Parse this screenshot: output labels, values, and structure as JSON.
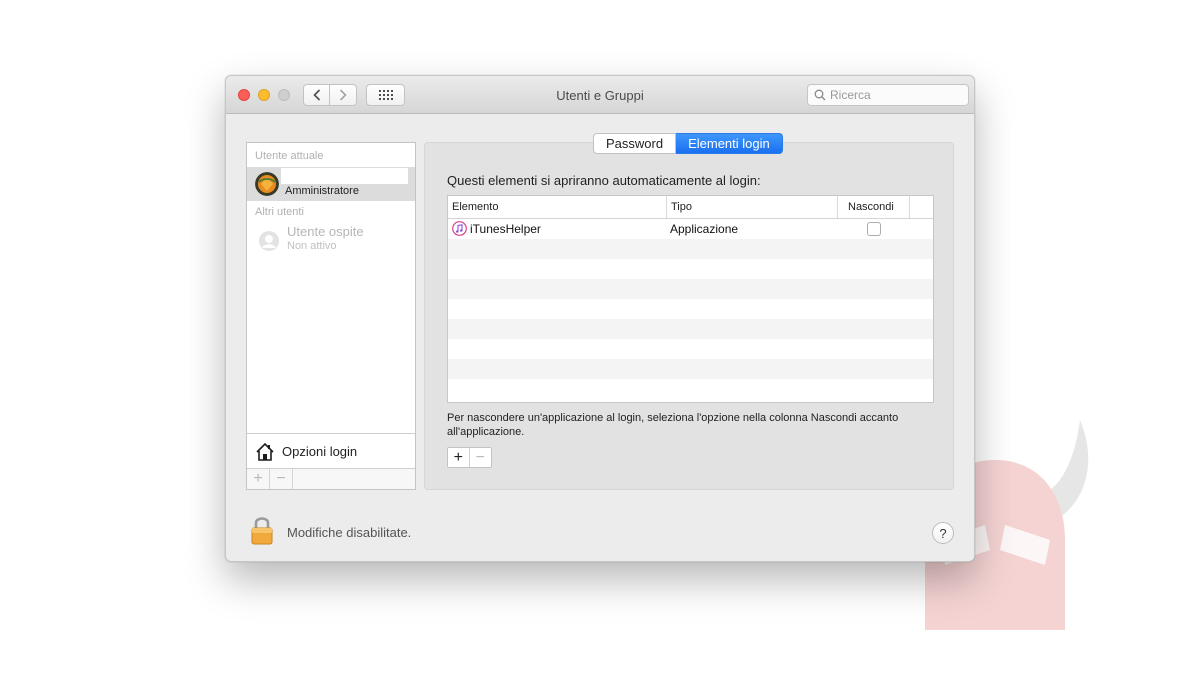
{
  "window": {
    "title": "Utenti e Gruppi",
    "search_placeholder": "Ricerca"
  },
  "sidebar": {
    "current_user_header": "Utente attuale",
    "current_user_role": "Amministratore",
    "other_users_header": "Altri utenti",
    "guest_name": "Utente ospite",
    "guest_status": "Non attivo",
    "login_options_label": "Opzioni login",
    "add_label": "+",
    "remove_label": "−"
  },
  "tabs": [
    {
      "label": "Password",
      "active": false
    },
    {
      "label": "Elementi login",
      "active": true
    }
  ],
  "login_items": {
    "heading": "Questi elementi si apriranno automaticamente al login:",
    "columns": [
      "Elemento",
      "Tipo",
      "Nascondi"
    ],
    "rows": [
      {
        "element": "iTunesHelper",
        "type": "Applicazione",
        "hidden": false,
        "icon": "itunes-icon"
      }
    ],
    "hint": "Per nascondere un'applicazione al login, seleziona l'opzione nella colonna Nascondi accanto all'applicazione.",
    "add_label": "+",
    "remove_label": "−"
  },
  "footer": {
    "lock_text": "Modifiche disabilitate.",
    "help_label": "?"
  },
  "colors": {
    "accent": "#1a70f0",
    "close": "#fc5f57",
    "minimize": "#fdbc2e"
  }
}
